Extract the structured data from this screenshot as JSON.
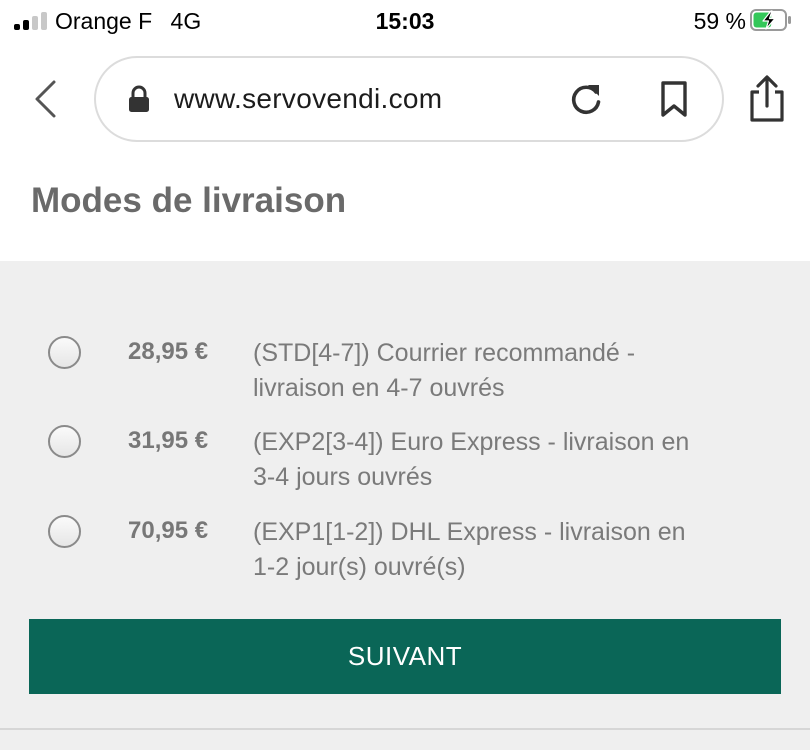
{
  "status_bar": {
    "carrier": "Orange F",
    "network": "4G",
    "time": "15:03",
    "battery_percent": "59 %",
    "battery_level": 0.59,
    "battery_charging": true,
    "signal_bars_filled": 2,
    "signal_bars_total": 4
  },
  "browser": {
    "url": "www.servovendi.com",
    "icons": [
      "back-chevron",
      "lock",
      "reload",
      "bookmark",
      "share"
    ]
  },
  "page": {
    "title": "Modes de livraison"
  },
  "shipping_options": [
    {
      "price": "28,95 €",
      "description_line1": "(STD[4-7]) Courrier recommandé -",
      "description_line2": "livraison en 4-7 ouvrés",
      "selected": false
    },
    {
      "price": "31,95 €",
      "description_line1": "(EXP2[3-4]) Euro Express - livraison en",
      "description_line2": "3-4 jours ouvrés",
      "selected": false
    },
    {
      "price": "70,95 €",
      "description_line1": "(EXP1[1-2]) DHL Express - livraison en",
      "description_line2": "1-2 jour(s) ouvré(s)",
      "selected": false
    }
  ],
  "next_button": {
    "label": "SUIVANT"
  },
  "colors": {
    "accent": "#0a6657",
    "panel_background": "#efefef",
    "title_text": "#6a6a6a",
    "option_text": "#7a7a7a",
    "battery_charging": "#34c759"
  }
}
